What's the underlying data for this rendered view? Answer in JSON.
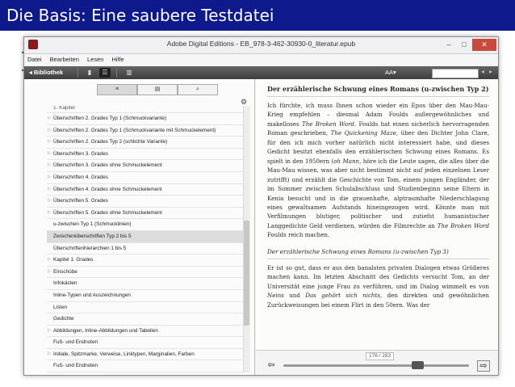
{
  "slide": {
    "title": "Die Basis: Eine saubere Testdatei"
  },
  "window": {
    "title": "Adobe Digital Editions - EB_978-3-462-30930-0_literatur.epub",
    "buttons": {
      "minimize": "–",
      "maximize": "□",
      "close": "✕"
    }
  },
  "menu": [
    "Datei",
    "Bearbeiten",
    "Lesen",
    "Hilfe"
  ],
  "toolbar": {
    "back_label": "◂ Bibliothek",
    "font_size_label": "AA▾",
    "prev_icon": "◂",
    "next_icon": "▸"
  },
  "left_tabs": [
    "≡",
    "▤",
    "⌕"
  ],
  "gear_icon": "⚙",
  "toc": [
    {
      "label": "1. Kapitel",
      "arrow": "",
      "cut": true
    },
    {
      "label": "Überschriften 2. Grades Typ 1 (Schmuckvariante)",
      "arrow": "▷"
    },
    {
      "label": "Überschriften 2. Grades Typ 1 (Schmuckvariante mit Schmuckelement)",
      "arrow": "▷"
    },
    {
      "label": "Überschriften 2. Grades Typ 2 (schlichte Variante)",
      "arrow": "▷"
    },
    {
      "label": "Überschriften 3. Grades",
      "arrow": "▷"
    },
    {
      "label": "Überschriften 3. Grades ohne Schmuckelement",
      "arrow": "▷"
    },
    {
      "label": "Überschriften 4. Grades",
      "arrow": "▷"
    },
    {
      "label": "Überschriften 4. Grades ohne Schmuckelement",
      "arrow": "▷"
    },
    {
      "label": "Überschriften 5. Grades",
      "arrow": "▷"
    },
    {
      "label": "Überschriften 5. Grades ohne Schmuckelement",
      "arrow": "▷"
    },
    {
      "label": "u-zwischen Typ 1 (Schmucklinien)",
      "arrow": ""
    },
    {
      "label": "Zwischenüberschriften Typ 2 bis 5",
      "arrow": "",
      "selected": true
    },
    {
      "label": "Überschriftenhierarchien 1 bis 5",
      "arrow": ""
    },
    {
      "label": "Kapitel 1. Grades",
      "arrow": "▷"
    },
    {
      "label": "Einschübe",
      "arrow": "▷"
    },
    {
      "label": "Infokästen",
      "arrow": ""
    },
    {
      "label": "Inline-Typen und Auszeichnungen",
      "arrow": ""
    },
    {
      "label": "Listen",
      "arrow": ""
    },
    {
      "label": "Gedichte",
      "arrow": ""
    },
    {
      "label": "Abbildungen, Inline-Abbildungen und Tabellen",
      "arrow": "▷"
    },
    {
      "label": "Fuß- und Endnoten",
      "arrow": ""
    },
    {
      "label": "Initiale, Spitzmarke, Verweise, Linktypen, Marginalien, Farben",
      "arrow": "▷"
    },
    {
      "label": "Fuß- und Endnoten",
      "arrow": ""
    }
  ],
  "reader": {
    "heading": "Der erzählerische Schwung eines Romans (u-zwischen Typ 2)",
    "para1": {
      "t1": "Ich fürchte, ich muss Ihnen schon wieder ein Epos über den Mau-Mau-Krieg empfehlen – diesmal Adam Foulds außergewöhnliches und makelloses ",
      "i1": "The Broken Word",
      "t2": ". Foulds hat einen sicherlich hervorragenden Roman geschrieben, ",
      "i2": "The Quickening Maze",
      "t3": ", über den Dichter John Clare, für den ich mich vorher natürlich nicht interessiert habe, und dieses Gedicht besitzt ebenfalls den erzählerischen Schwung eines Romans. Es spielt in den 1950ern (",
      "i3": "oh Mann",
      "t4": ", höre ich die Leute sagen, die alles über die Mau-Mau wissen, was aber nicht bestimmt nicht auf jeden einzelnen Leser zutrifft) und erzählt die Geschichte von Tom, einem jungen Engländer, der im Sommer zwischen Schulabschluss und Studienbeginn seine Eltern in Kenia besucht und in die grauenhafte, alptraumhafte Niederschlagung eines gewaltsamen Aufstands hineingezogen wird. Könnte man mit Verfilmungen blutiger, politischer und zutiefst humanistischer Langgedichte Geld verdienen, würden die Filmrechte an ",
      "i4": "The Broken Word",
      "t5": " Foulds reich machen."
    },
    "subheading": "Der erzählerische Schwung eines Romans (u-zwischen Typ 3)",
    "para2": {
      "t1": "Er ist so gut, dass er aus den banalsten privaten Dialogen etwas Größeres machen kann. Im letzten Abschnitt des Gedichts versucht Tom, an der Universität eine junge Frau zu verführen, und im Dialog wimmelt es von ",
      "i1": "Neins",
      "t2": " und ",
      "i2": "Das gehört sich nichts",
      "t3": ", den direkten und gewöhnlichen Zurückweisungen bei einem Flirt in den 50ern. Was der"
    },
    "page_indicator": "176 / 283",
    "progress": 0.72
  }
}
